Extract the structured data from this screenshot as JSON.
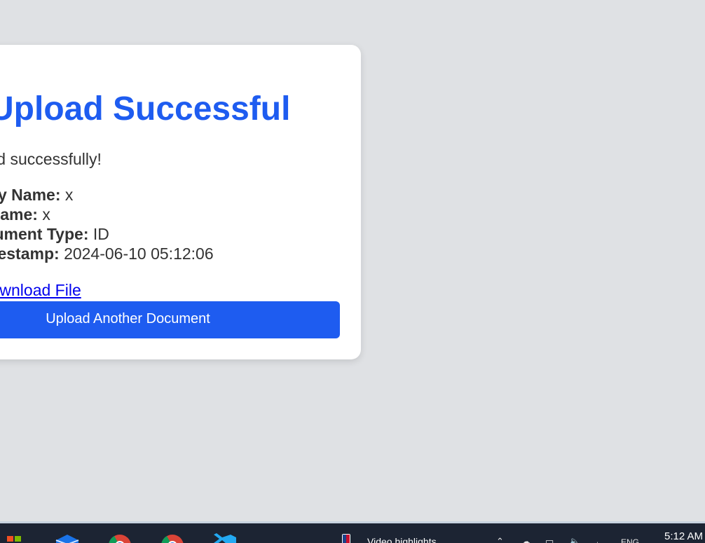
{
  "card": {
    "title": "Upload Successful",
    "message": "File uploaded successfully!",
    "details": [
      {
        "label": "Company Name:",
        "value": "x"
      },
      {
        "label": "Borrower Name:",
        "value": "x"
      },
      {
        "label": "Document Type:",
        "value": "ID"
      },
      {
        "label": "Timestamp:",
        "value": "2024-06-10 05:12:06"
      }
    ],
    "download_link": "Download File",
    "upload_another_button": "Upload Another Document"
  },
  "taskbar": {
    "apps": [
      "start-icon",
      "mail-icon",
      "chrome-icon",
      "chrome-icon",
      "vscode-icon"
    ],
    "news_text": "Video highlights",
    "language": "ENG",
    "clock": "5:12 AM"
  },
  "colors": {
    "accent": "#1e5cf0",
    "background": "#dfe1e4",
    "link": "#0000ee"
  }
}
